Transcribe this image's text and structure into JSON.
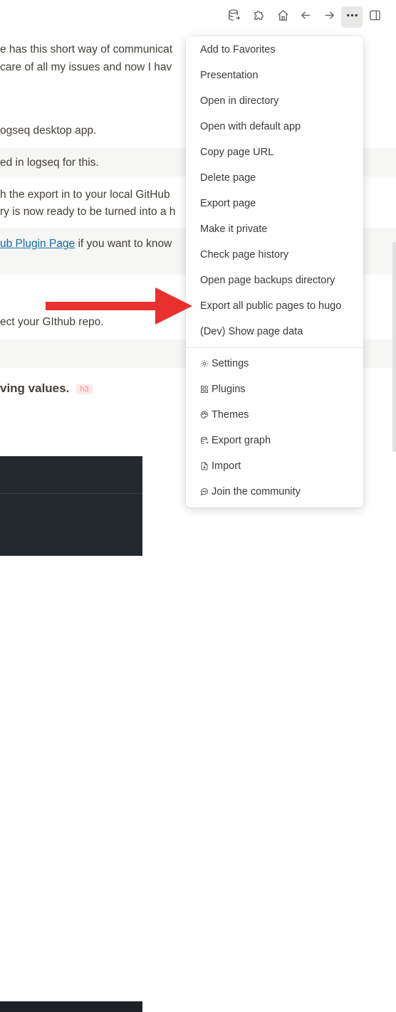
{
  "page": {
    "lines": [
      "e has this short way of communicat",
      "care of all my issues and now I hav",
      "ogseq desktop app.",
      "ed in logseq for this.",
      "h the export in to your local GitHub",
      "ry is now ready to be turned into a h",
      "ub Plugin Page",
      " if you want to know",
      "ect your GIthub repo."
    ],
    "heading": "ving values.",
    "heading_tag": "h3"
  },
  "menu": {
    "items": [
      "Add to Favorites",
      "Presentation",
      "Open in directory",
      "Open with default app",
      "Copy page URL",
      "Delete page",
      "Export page",
      "Make it private",
      "Check page history",
      "Open page backups directory",
      "Export all public pages to hugo",
      "(Dev) Show page data"
    ],
    "sub_items": [
      {
        "label": "Settings",
        "icon": "gear-icon"
      },
      {
        "label": "Plugins",
        "icon": "plugins-icon"
      },
      {
        "label": "Themes",
        "icon": "palette-icon"
      },
      {
        "label": "Export graph",
        "icon": "database-export-icon"
      },
      {
        "label": "Import",
        "icon": "file-import-icon"
      },
      {
        "label": "Join the community",
        "icon": "message-icon"
      }
    ]
  },
  "colors": {
    "accent_arrow": "#e8302e",
    "link": "#106ba3"
  }
}
